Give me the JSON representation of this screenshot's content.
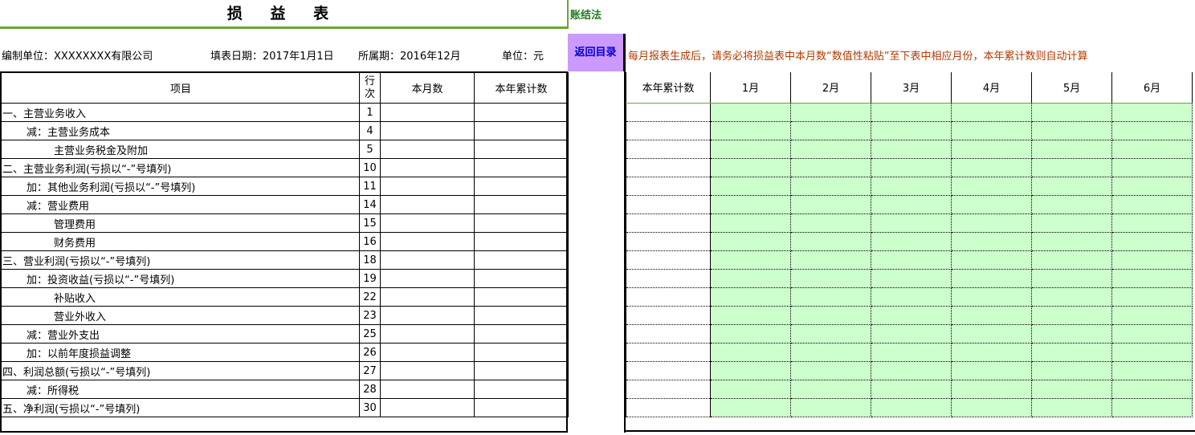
{
  "title": "损 益 表",
  "method": "账结法",
  "info": {
    "company": "编制单位：XXXXXXXX有限公司",
    "fill_date": "填表日期：2017年1月1日",
    "period": "所属期：2016年12月",
    "unit": "单位：元"
  },
  "return_button": "返回目录",
  "notice": "每月报表生成后，请务必将损益表中本月数“数值性粘贴”至下表中相应月份，本年累计数则自动计算",
  "left_table": {
    "headers": {
      "item": "项目",
      "line": "行次",
      "month": "本月数",
      "ytd": "本年累计数"
    },
    "rows": [
      {
        "item": "一、主营业务收入",
        "level": 0,
        "line": "1"
      },
      {
        "item": "减：主营业务成本",
        "level": 1,
        "line": "4"
      },
      {
        "item": "主营业务税金及附加",
        "level": 2,
        "line": "5"
      },
      {
        "item": "二、主营业务利润(亏损以“-”号填列)",
        "level": 0,
        "line": "10"
      },
      {
        "item": "加：其他业务利润(亏损以“-”号填列)",
        "level": 1,
        "line": "11"
      },
      {
        "item": "减：营业费用",
        "level": 1,
        "line": "14"
      },
      {
        "item": "管理费用",
        "level": 2,
        "line": "15"
      },
      {
        "item": "财务费用",
        "level": 2,
        "line": "16"
      },
      {
        "item": "三、营业利润(亏损以“-”号填列)",
        "level": 0,
        "line": "18"
      },
      {
        "item": "加：投资收益(亏损以“-”号填列)",
        "level": 1,
        "line": "19"
      },
      {
        "item": "补贴收入",
        "level": 2,
        "line": "22"
      },
      {
        "item": "营业外收入",
        "level": 2,
        "line": "23"
      },
      {
        "item": "减：营业外支出",
        "level": 1,
        "line": "25"
      },
      {
        "item": "加：以前年度损益调整",
        "level": 1,
        "line": "26"
      },
      {
        "item": "四、利润总额(亏损以“-”号填列)",
        "level": 0,
        "line": "27"
      },
      {
        "item": "减：所得税",
        "level": 1,
        "line": "28"
      },
      {
        "item": "五、净利润(亏损以“-”号填列)",
        "level": 0,
        "line": "30"
      }
    ]
  },
  "right_table": {
    "headers": [
      "本年累计数",
      "1月",
      "2月",
      "3月",
      "4月",
      "5月",
      "6月"
    ],
    "row_count": 17
  },
  "colors": {
    "accent_green": "#6aa632",
    "input_fill": "#ccffcc",
    "button_fill": "#cc99ff",
    "notice_text": "#b03a00"
  }
}
